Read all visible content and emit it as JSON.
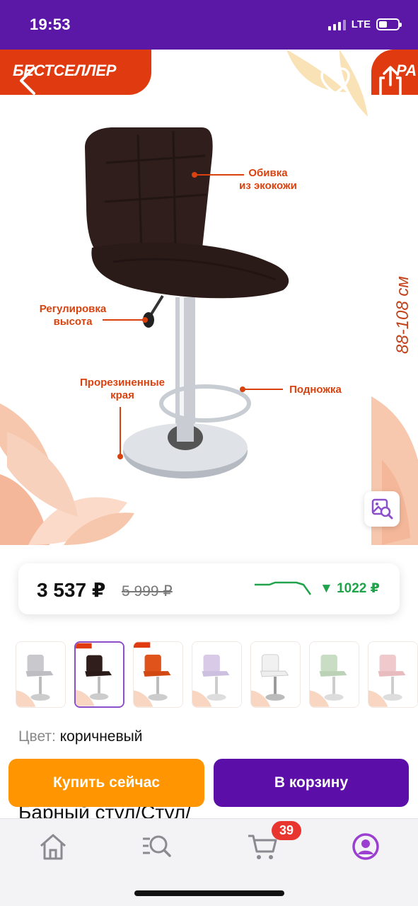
{
  "status_bar": {
    "time": "19:53",
    "network": "LTE",
    "battery_level_percent": 45
  },
  "hero": {
    "badge_left": "БЕСТСЕЛЛЕР",
    "badge_right": "РА",
    "annotations": {
      "upholstery": "Обивка\nиз экокожи",
      "height_adjust": "Регулировка\nвысота",
      "rubber_edges": "Прорезиненные\nкрая",
      "footrest": "Подножка"
    },
    "size_label": "88-108 см",
    "icons": {
      "back": "chevron-left-icon",
      "favorite": "heart-icon",
      "share": "share-icon",
      "image_search": "image-search-icon"
    }
  },
  "price": {
    "current": "3 537 ₽",
    "old": "5 999 ₽",
    "drop": "▼ 1022 ₽",
    "drop_color": "#21a34b"
  },
  "thumbnails": {
    "colors": [
      "gray",
      "brown",
      "orange",
      "lavender",
      "white",
      "green",
      "pink"
    ],
    "selected_index": 1
  },
  "color": {
    "label": "Цвет:",
    "value": "коричневый"
  },
  "title_peek": "Барный стул/Стул/",
  "buttons": {
    "buy_now": "Купить сейчас",
    "add_to_cart": "В корзину",
    "buy_color": "#ff9500",
    "cart_color": "#5b0fa8"
  },
  "tabbar": {
    "items": [
      "home-icon",
      "search-icon",
      "cart-icon",
      "profile-icon"
    ],
    "active_index": 3,
    "cart_count": "39"
  }
}
